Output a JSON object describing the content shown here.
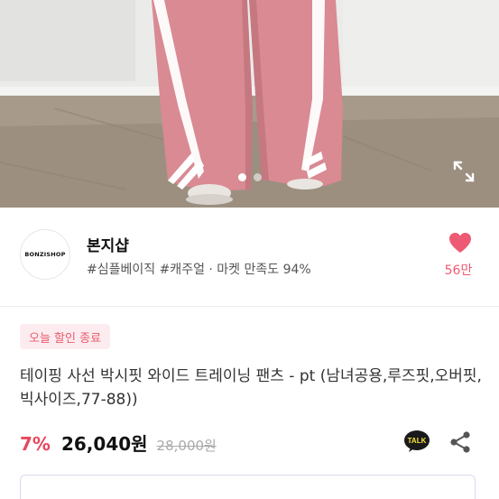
{
  "gallery": {
    "image": "pink-track-pants-photo",
    "dot_count": 2,
    "active_dot": 0,
    "expand_icon": "expand-icon"
  },
  "shop": {
    "logo_text": "BONZISHOP",
    "name": "본지샵",
    "tags": "#심플베이직 #캐주얼 · 마켓 만족도 94%",
    "like_icon": "heart-icon",
    "like_count": "56만"
  },
  "badge": {
    "label": "오늘 할인 종료"
  },
  "product": {
    "title": "테이핑 사선 박시핏 와이드 트레이닝 팬츠 - pt (남녀공용,루즈핏,오버핏,빅사이즈,77-88))"
  },
  "price": {
    "discount": "7%",
    "sale": "26,040원",
    "original": "28,000원"
  },
  "actions": {
    "talk_label": "TALK",
    "share_icon": "share-icon"
  },
  "coupon_card": {
    "text": ""
  },
  "colors": {
    "accent": "#e8475e",
    "heart": "#ee5a73",
    "badge_bg": "#fdecef",
    "pants": "#d98a92",
    "stripe": "#ffffff"
  }
}
